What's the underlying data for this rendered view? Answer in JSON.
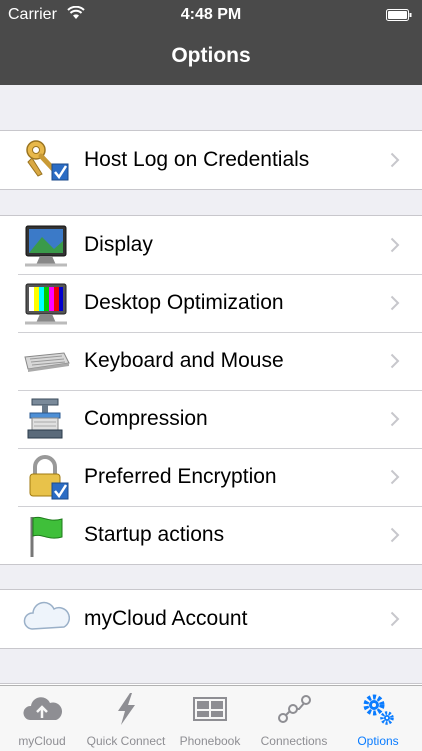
{
  "status_bar": {
    "carrier": "Carrier",
    "time": "4:48 PM"
  },
  "nav": {
    "title": "Options"
  },
  "groups": [
    {
      "rows": [
        {
          "label": "Host Log on Credentials",
          "icon": "key-check-icon"
        }
      ]
    },
    {
      "rows": [
        {
          "label": "Display",
          "icon": "monitor-icon"
        },
        {
          "label": "Desktop Optimization",
          "icon": "monitor-testpattern-icon"
        },
        {
          "label": "Keyboard and Mouse",
          "icon": "keyboard-icon"
        },
        {
          "label": "Compression",
          "icon": "compression-press-icon"
        },
        {
          "label": "Preferred Encryption",
          "icon": "padlock-check-icon"
        },
        {
          "label": "Startup actions",
          "icon": "green-flag-icon"
        }
      ]
    },
    {
      "rows": [
        {
          "label": "myCloud Account",
          "icon": "cloud-icon"
        }
      ]
    }
  ],
  "tabs": [
    {
      "label": "myCloud",
      "icon": "cloud-upload-icon",
      "active": false
    },
    {
      "label": "Quick Connect",
      "icon": "lightning-icon",
      "active": false
    },
    {
      "label": "Phonebook",
      "icon": "phonebook-icon",
      "active": false
    },
    {
      "label": "Connections",
      "icon": "connections-icon",
      "active": false
    },
    {
      "label": "Options",
      "icon": "gears-icon",
      "active": true
    }
  ],
  "colors": {
    "bar": "#4a4a4a",
    "accent": "#0a7cff",
    "background": "#efeff4"
  }
}
